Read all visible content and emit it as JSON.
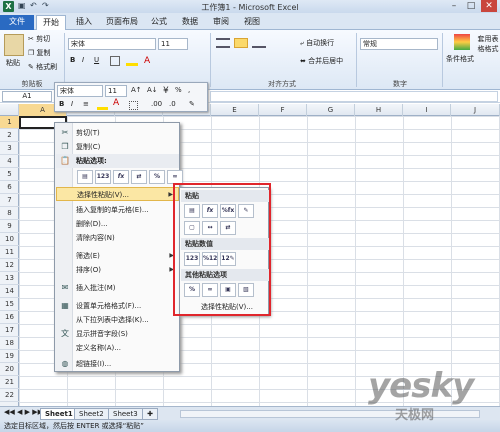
{
  "titlebar": {
    "title": "工作簿1 - Microsoft Excel",
    "app_icon": "X",
    "min": "–",
    "max": "□",
    "close": "✕"
  },
  "tabs": [
    "文件",
    "开始",
    "插入",
    "页面布局",
    "公式",
    "数据",
    "审阅",
    "视图"
  ],
  "ribbon": {
    "clipboard": {
      "paste": "粘贴",
      "cut": "剪切",
      "copy": "复制",
      "format_painter": "格式刷",
      "label": "剪贴板"
    },
    "font": {
      "name": "宋体",
      "size": "11",
      "bold": "B",
      "italic": "I",
      "underline": "U"
    },
    "alignment": {
      "wrap": "自动换行",
      "merge": "合并后居中",
      "label": "对齐方式"
    },
    "number": {
      "format": "常规",
      "label": "数字"
    },
    "styles": {
      "conditional": "条件格式",
      "table": "套用表格格式"
    }
  },
  "mini_toolbar": {
    "font": "宋体",
    "size": "11",
    "bold": "B",
    "italic": "I",
    "percent": "%",
    "comma": ","
  },
  "namebox": "A1",
  "columns": [
    "A",
    "B",
    "C",
    "D",
    "E",
    "F",
    "G",
    "H",
    "I",
    "J"
  ],
  "rows": [
    "1",
    "2",
    "3",
    "4",
    "5",
    "6",
    "7",
    "8",
    "9",
    "10",
    "11",
    "12",
    "13",
    "14",
    "15",
    "16",
    "17",
    "18",
    "19",
    "20",
    "21",
    "22"
  ],
  "context_menu": {
    "cut": "剪切(T)",
    "copy": "复制(C)",
    "paste_options": "粘贴选项:",
    "paste_special": "选择性粘贴(V)...",
    "insert_copied": "插入复制的单元格(E)...",
    "delete": "删除(D)...",
    "clear": "清除内容(N)",
    "filter": "筛选(E)",
    "sort": "排序(O)",
    "insert_comment": "插入批注(M)",
    "format_cells": "设置单元格格式(F)...",
    "pick_list": "从下拉列表中选择(K)...",
    "phonetic": "显示拼音字段(S)",
    "define_name": "定义名称(A)...",
    "hyperlink": "超链接(I)..."
  },
  "submenu": {
    "paste_header": "粘贴",
    "paste_values_header": "粘贴数值",
    "other_header": "其他粘贴选项",
    "paste_special": "选择性粘贴(V)..."
  },
  "sheets": [
    "Sheet1",
    "Sheet2",
    "Sheet3"
  ],
  "status": "选定目标区域，然后按 ENTER 或选择“粘贴”",
  "watermark": {
    "logo": "yesky",
    "sub": "天极网"
  },
  "colors": {
    "file_tab": "#2a6ac2",
    "highlight": "#fbe7a4",
    "red_box": "#e0262c"
  }
}
